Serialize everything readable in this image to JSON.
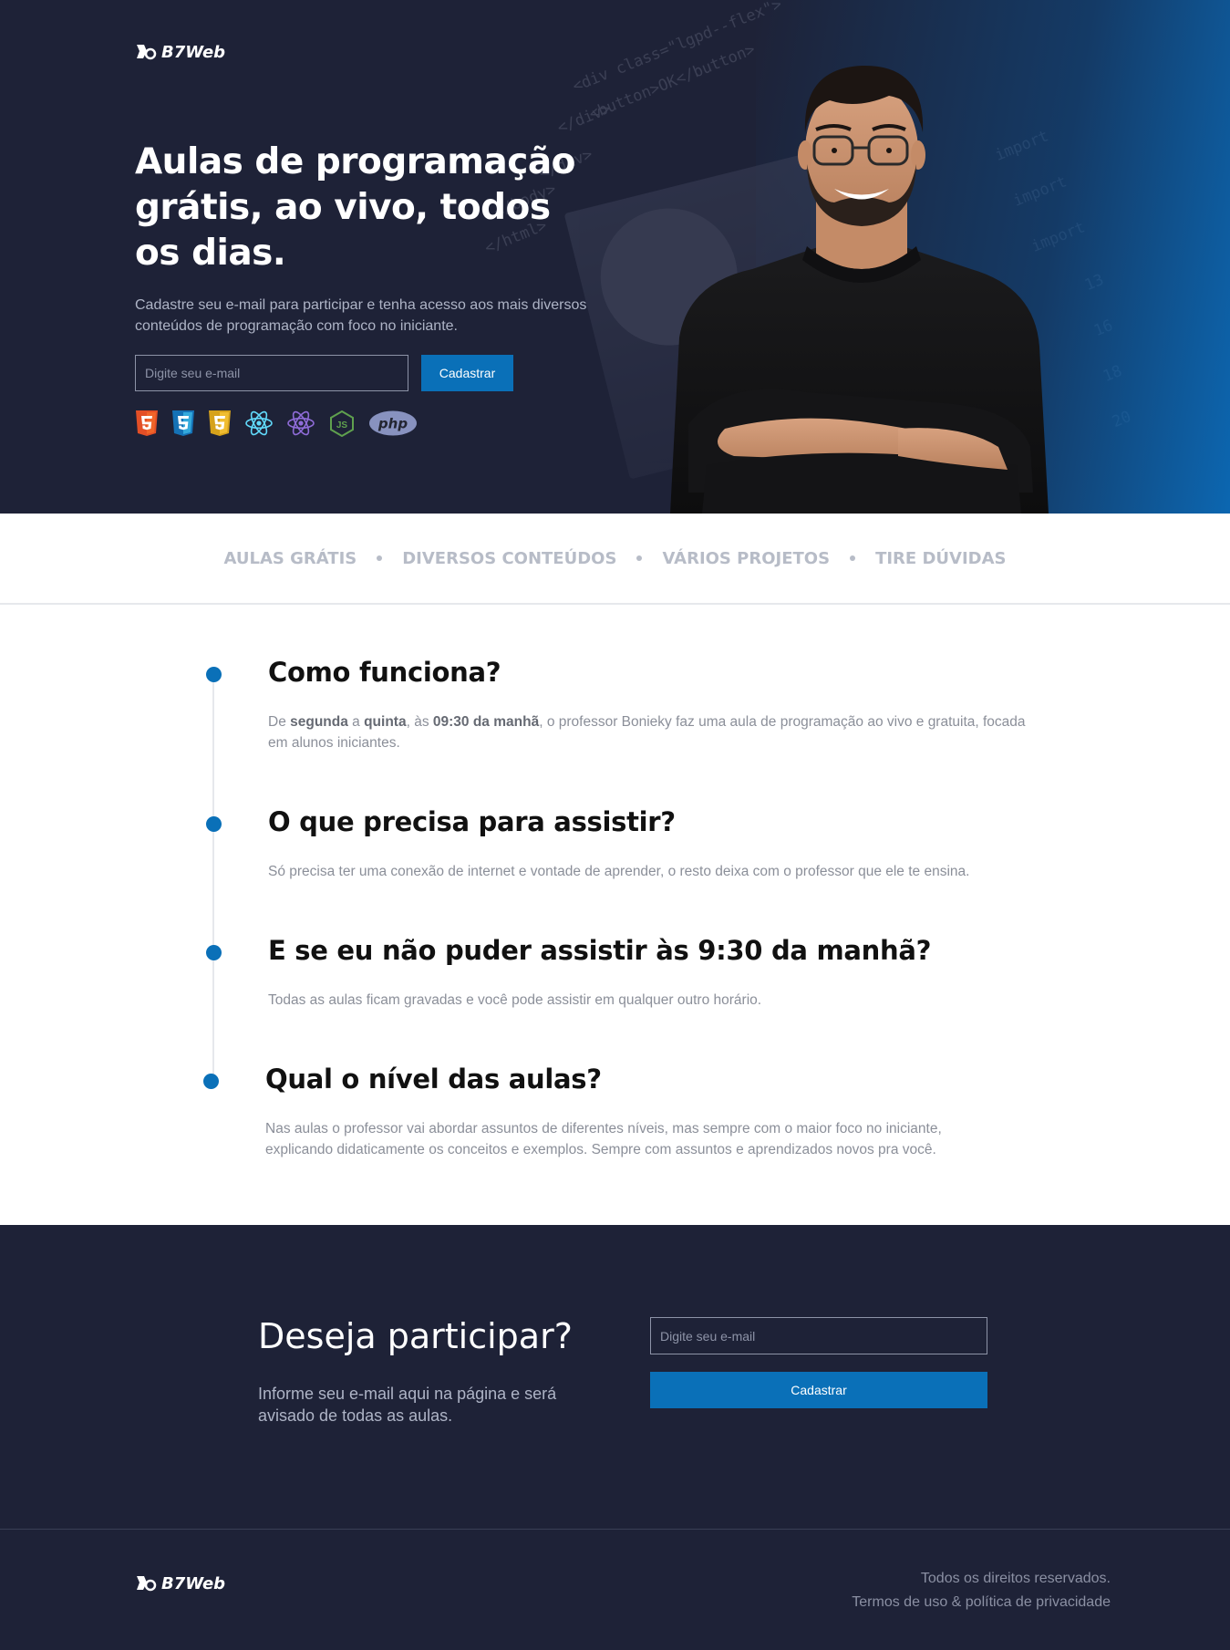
{
  "brand": {
    "name": "B7Web"
  },
  "hero": {
    "title": "Aulas de programação grátis, ao vivo, todos os dias.",
    "description": "Cadastre seu e-mail para participar e tenha acesso aos mais diversos conteúdos de programação com foco no iniciante.",
    "email_placeholder": "Digite seu e-mail",
    "submit_label": "Cadastrar",
    "tech_icons": [
      "html5-icon",
      "css3-icon",
      "javascript-icon",
      "react-icon",
      "react-native-icon",
      "nodejs-icon",
      "php-icon"
    ],
    "php_label": "php",
    "js_label": "JS"
  },
  "features": [
    "AULAS GRÁTIS",
    "DIVERSOS CONTEÚDOS",
    "VÁRIOS PROJETOS",
    "TIRE DÚVIDAS"
  ],
  "faq": [
    {
      "question": "Como funciona?",
      "answer_parts": [
        "De ",
        "segunda",
        " a ",
        "quinta",
        ", às ",
        "09:30 da manhã",
        ", o professor Bonieky faz uma aula de programação ao vivo e gratuita, focada em alunos iniciantes."
      ]
    },
    {
      "question": "O que precisa para assistir?",
      "answer": "Só precisa ter uma conexão de internet e vontade de aprender, o resto deixa com o professor que ele te ensina."
    },
    {
      "question": "E se eu não puder assistir às 9:30 da manhã?",
      "answer": "Todas as aulas ficam gravadas e você pode assistir em qualquer outro horário."
    },
    {
      "question": "Qual o nível das aulas?",
      "answer": "Nas aulas o professor vai abordar assuntos de diferentes níveis, mas sempre com o maior foco no iniciante, explicando didaticamente os conceitos e exemplos. Sempre com assuntos e aprendizados novos pra você."
    }
  ],
  "cta": {
    "title": "Deseja participar?",
    "description": "Informe seu e-mail aqui na página e será avisado de todas as aulas.",
    "email_placeholder": "Digite seu e-mail",
    "submit_label": "Cadastrar"
  },
  "footer": {
    "rights": "Todos os direitos reservados.",
    "terms": "Termos de uso & política de privacidade"
  },
  "colors": {
    "navy": "#1e2237",
    "accent": "#0a70b8",
    "muted": "#b7bcc7"
  }
}
